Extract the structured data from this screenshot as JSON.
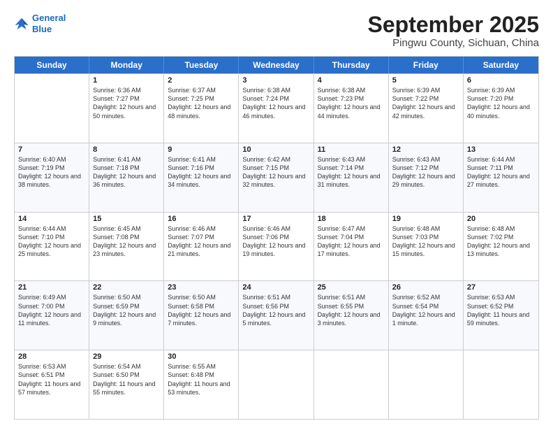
{
  "header": {
    "logo_line1": "General",
    "logo_line2": "Blue",
    "month": "September 2025",
    "location": "Pingwu County, Sichuan, China"
  },
  "weekdays": [
    "Sunday",
    "Monday",
    "Tuesday",
    "Wednesday",
    "Thursday",
    "Friday",
    "Saturday"
  ],
  "weeks": [
    [
      {
        "day": "",
        "sunrise": "",
        "sunset": "",
        "daylight": ""
      },
      {
        "day": "1",
        "sunrise": "Sunrise: 6:36 AM",
        "sunset": "Sunset: 7:27 PM",
        "daylight": "Daylight: 12 hours and 50 minutes."
      },
      {
        "day": "2",
        "sunrise": "Sunrise: 6:37 AM",
        "sunset": "Sunset: 7:25 PM",
        "daylight": "Daylight: 12 hours and 48 minutes."
      },
      {
        "day": "3",
        "sunrise": "Sunrise: 6:38 AM",
        "sunset": "Sunset: 7:24 PM",
        "daylight": "Daylight: 12 hours and 46 minutes."
      },
      {
        "day": "4",
        "sunrise": "Sunrise: 6:38 AM",
        "sunset": "Sunset: 7:23 PM",
        "daylight": "Daylight: 12 hours and 44 minutes."
      },
      {
        "day": "5",
        "sunrise": "Sunrise: 6:39 AM",
        "sunset": "Sunset: 7:22 PM",
        "daylight": "Daylight: 12 hours and 42 minutes."
      },
      {
        "day": "6",
        "sunrise": "Sunrise: 6:39 AM",
        "sunset": "Sunset: 7:20 PM",
        "daylight": "Daylight: 12 hours and 40 minutes."
      }
    ],
    [
      {
        "day": "7",
        "sunrise": "Sunrise: 6:40 AM",
        "sunset": "Sunset: 7:19 PM",
        "daylight": "Daylight: 12 hours and 38 minutes."
      },
      {
        "day": "8",
        "sunrise": "Sunrise: 6:41 AM",
        "sunset": "Sunset: 7:18 PM",
        "daylight": "Daylight: 12 hours and 36 minutes."
      },
      {
        "day": "9",
        "sunrise": "Sunrise: 6:41 AM",
        "sunset": "Sunset: 7:16 PM",
        "daylight": "Daylight: 12 hours and 34 minutes."
      },
      {
        "day": "10",
        "sunrise": "Sunrise: 6:42 AM",
        "sunset": "Sunset: 7:15 PM",
        "daylight": "Daylight: 12 hours and 32 minutes."
      },
      {
        "day": "11",
        "sunrise": "Sunrise: 6:43 AM",
        "sunset": "Sunset: 7:14 PM",
        "daylight": "Daylight: 12 hours and 31 minutes."
      },
      {
        "day": "12",
        "sunrise": "Sunrise: 6:43 AM",
        "sunset": "Sunset: 7:12 PM",
        "daylight": "Daylight: 12 hours and 29 minutes."
      },
      {
        "day": "13",
        "sunrise": "Sunrise: 6:44 AM",
        "sunset": "Sunset: 7:11 PM",
        "daylight": "Daylight: 12 hours and 27 minutes."
      }
    ],
    [
      {
        "day": "14",
        "sunrise": "Sunrise: 6:44 AM",
        "sunset": "Sunset: 7:10 PM",
        "daylight": "Daylight: 12 hours and 25 minutes."
      },
      {
        "day": "15",
        "sunrise": "Sunrise: 6:45 AM",
        "sunset": "Sunset: 7:08 PM",
        "daylight": "Daylight: 12 hours and 23 minutes."
      },
      {
        "day": "16",
        "sunrise": "Sunrise: 6:46 AM",
        "sunset": "Sunset: 7:07 PM",
        "daylight": "Daylight: 12 hours and 21 minutes."
      },
      {
        "day": "17",
        "sunrise": "Sunrise: 6:46 AM",
        "sunset": "Sunset: 7:06 PM",
        "daylight": "Daylight: 12 hours and 19 minutes."
      },
      {
        "day": "18",
        "sunrise": "Sunrise: 6:47 AM",
        "sunset": "Sunset: 7:04 PM",
        "daylight": "Daylight: 12 hours and 17 minutes."
      },
      {
        "day": "19",
        "sunrise": "Sunrise: 6:48 AM",
        "sunset": "Sunset: 7:03 PM",
        "daylight": "Daylight: 12 hours and 15 minutes."
      },
      {
        "day": "20",
        "sunrise": "Sunrise: 6:48 AM",
        "sunset": "Sunset: 7:02 PM",
        "daylight": "Daylight: 12 hours and 13 minutes."
      }
    ],
    [
      {
        "day": "21",
        "sunrise": "Sunrise: 6:49 AM",
        "sunset": "Sunset: 7:00 PM",
        "daylight": "Daylight: 12 hours and 11 minutes."
      },
      {
        "day": "22",
        "sunrise": "Sunrise: 6:50 AM",
        "sunset": "Sunset: 6:59 PM",
        "daylight": "Daylight: 12 hours and 9 minutes."
      },
      {
        "day": "23",
        "sunrise": "Sunrise: 6:50 AM",
        "sunset": "Sunset: 6:58 PM",
        "daylight": "Daylight: 12 hours and 7 minutes."
      },
      {
        "day": "24",
        "sunrise": "Sunrise: 6:51 AM",
        "sunset": "Sunset: 6:56 PM",
        "daylight": "Daylight: 12 hours and 5 minutes."
      },
      {
        "day": "25",
        "sunrise": "Sunrise: 6:51 AM",
        "sunset": "Sunset: 6:55 PM",
        "daylight": "Daylight: 12 hours and 3 minutes."
      },
      {
        "day": "26",
        "sunrise": "Sunrise: 6:52 AM",
        "sunset": "Sunset: 6:54 PM",
        "daylight": "Daylight: 12 hours and 1 minute."
      },
      {
        "day": "27",
        "sunrise": "Sunrise: 6:53 AM",
        "sunset": "Sunset: 6:52 PM",
        "daylight": "Daylight: 11 hours and 59 minutes."
      }
    ],
    [
      {
        "day": "28",
        "sunrise": "Sunrise: 6:53 AM",
        "sunset": "Sunset: 6:51 PM",
        "daylight": "Daylight: 11 hours and 57 minutes."
      },
      {
        "day": "29",
        "sunrise": "Sunrise: 6:54 AM",
        "sunset": "Sunset: 6:50 PM",
        "daylight": "Daylight: 11 hours and 55 minutes."
      },
      {
        "day": "30",
        "sunrise": "Sunrise: 6:55 AM",
        "sunset": "Sunset: 6:48 PM",
        "daylight": "Daylight: 11 hours and 53 minutes."
      },
      {
        "day": "",
        "sunrise": "",
        "sunset": "",
        "daylight": ""
      },
      {
        "day": "",
        "sunrise": "",
        "sunset": "",
        "daylight": ""
      },
      {
        "day": "",
        "sunrise": "",
        "sunset": "",
        "daylight": ""
      },
      {
        "day": "",
        "sunrise": "",
        "sunset": "",
        "daylight": ""
      }
    ]
  ]
}
